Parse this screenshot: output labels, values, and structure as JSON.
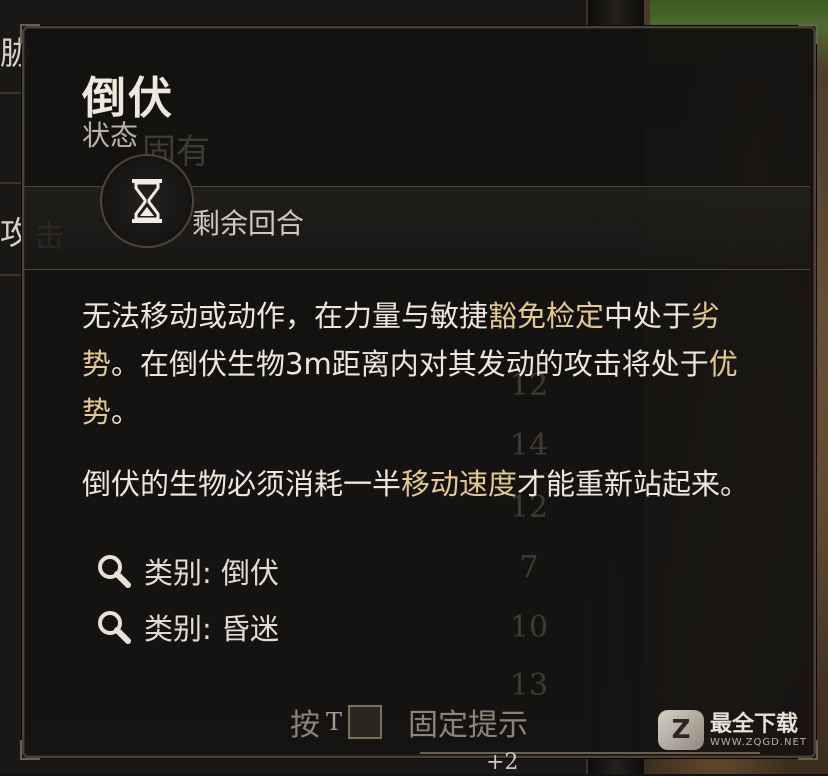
{
  "background": {
    "left_text_top": "胁",
    "left_text_mid": "攻",
    "ghost_attack": "击",
    "ghost_header": "固有",
    "ghost_numbers": [
      "12",
      "14",
      "12",
      "7",
      "10",
      "13"
    ],
    "ghost_bottom": "+2"
  },
  "tooltip": {
    "title": "倒伏",
    "subtitle": "状态",
    "duration_label": "剩余回合",
    "paragraph1": [
      {
        "text": "无法移动或动作，在力量与敏捷",
        "highlight": false
      },
      {
        "text": "豁免检定",
        "highlight": true
      },
      {
        "text": "中处于",
        "highlight": false
      },
      {
        "text": "劣势",
        "highlight": true
      },
      {
        "text": "。在倒伏生物3m距离内对其发动的攻击将处于",
        "highlight": false
      },
      {
        "text": "优势",
        "highlight": true
      },
      {
        "text": "。",
        "highlight": false
      }
    ],
    "paragraph2": [
      {
        "text": "倒伏的生物必须消耗一半",
        "highlight": false
      },
      {
        "text": "移动速度",
        "highlight": true
      },
      {
        "text": "才能重新站起来。",
        "highlight": false
      }
    ],
    "tags": [
      {
        "label": "类别: 倒伏",
        "icon": "magnifier-icon"
      },
      {
        "label": "类别: 昏迷",
        "icon": "magnifier-icon"
      }
    ],
    "footer": {
      "press": "按",
      "key": "T",
      "action": "固定提示"
    }
  },
  "watermark": {
    "logo": "Z",
    "name": "最全下载",
    "site": "WWW.ZQGD.NET"
  },
  "colors": {
    "highlight": "#e4c98a",
    "text": "#ede7db",
    "frame": "#4a4238"
  }
}
